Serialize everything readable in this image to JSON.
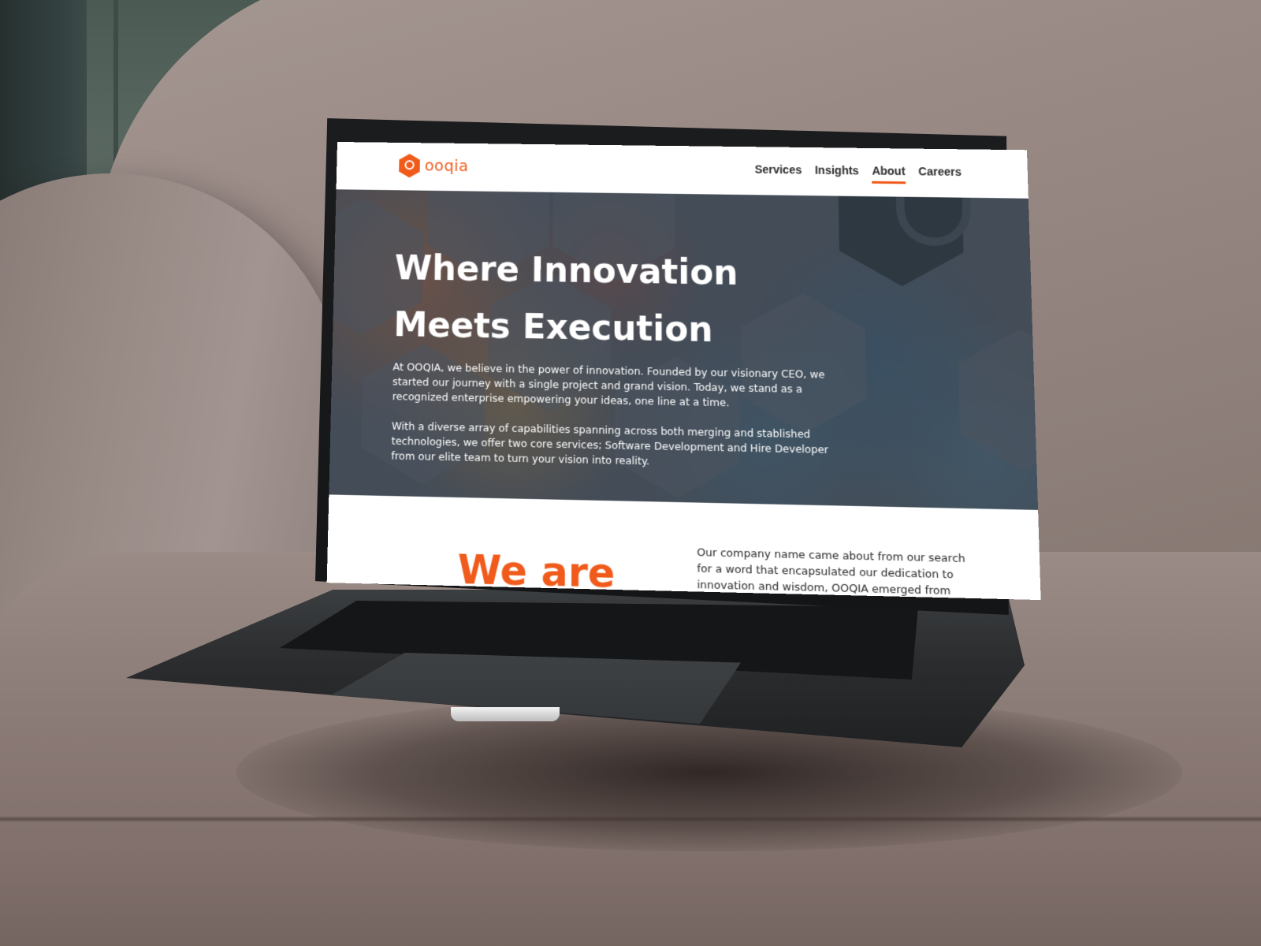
{
  "brand": {
    "name": "ooqia",
    "accent_color": "#f05a1a"
  },
  "nav": {
    "items": [
      {
        "label": "Services",
        "active": false
      },
      {
        "label": "Insights",
        "active": false
      },
      {
        "label": "About",
        "active": true
      },
      {
        "label": "Careers",
        "active": false
      }
    ]
  },
  "hero": {
    "title_line1": "Where Innovation",
    "title_line2": "Meets Execution",
    "paragraph1": "At OOQIA, we believe in the power of innovation. Founded by our visionary CEO, we started our journey with a single project and grand vision. Today, we stand as a recognized enterprise empowering your ideas, one line at a time.",
    "paragraph2": "With a diverse array of capabilities spanning across both merging and stablished technologies, we offer two core services; Software Development and Hire Developer from our elite team to turn your vision into reality."
  },
  "about": {
    "heading": "We are",
    "paragraph": "Our company name came about from our search for a word that encapsulated our dedication to innovation and wisdom, OOQIA emerged from an"
  }
}
